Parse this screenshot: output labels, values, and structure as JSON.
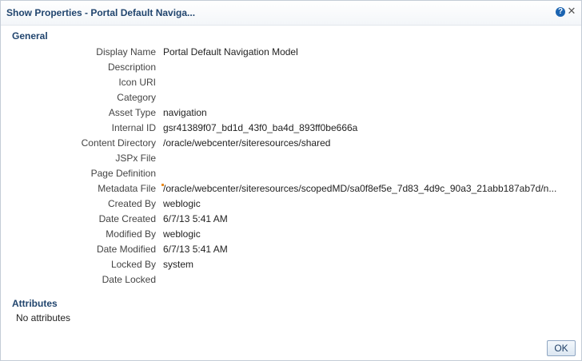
{
  "dialog": {
    "title": "Show Properties - Portal Default Naviga...",
    "help_icon": "help-icon",
    "close_icon": "close-icon"
  },
  "general": {
    "header": "General",
    "properties": [
      {
        "label": "Display Name",
        "value": "Portal Default Navigation Model"
      },
      {
        "label": "Description",
        "value": ""
      },
      {
        "label": "Icon URI",
        "value": ""
      },
      {
        "label": "Category",
        "value": ""
      },
      {
        "label": "Asset Type",
        "value": "navigation"
      },
      {
        "label": "Internal ID",
        "value": "gsr41389f07_bd1d_43f0_ba4d_893ff0be666a"
      },
      {
        "label": "Content Directory",
        "value": "/oracle/webcenter/siteresources/shared"
      },
      {
        "label": "JSPx File",
        "value": ""
      },
      {
        "label": "Page Definition",
        "value": ""
      },
      {
        "label": "Metadata File",
        "value": "/oracle/webcenter/siteresources/scopedMD/sa0f8ef5e_7d83_4d9c_90a3_21abb187ab7d/n..."
      },
      {
        "label": "Created By",
        "value": "weblogic"
      },
      {
        "label": "Date Created",
        "value": "6/7/13 5:41 AM"
      },
      {
        "label": "Modified By",
        "value": "weblogic"
      },
      {
        "label": "Date Modified",
        "value": "6/7/13 5:41 AM"
      },
      {
        "label": "Locked By",
        "value": "system"
      },
      {
        "label": "Date Locked",
        "value": ""
      }
    ]
  },
  "attributes": {
    "header": "Attributes",
    "empty_text": "No attributes"
  },
  "footer": {
    "ok_label": "OK"
  },
  "colors": {
    "header_text": "#21456e",
    "marker": "#e98a1e"
  }
}
